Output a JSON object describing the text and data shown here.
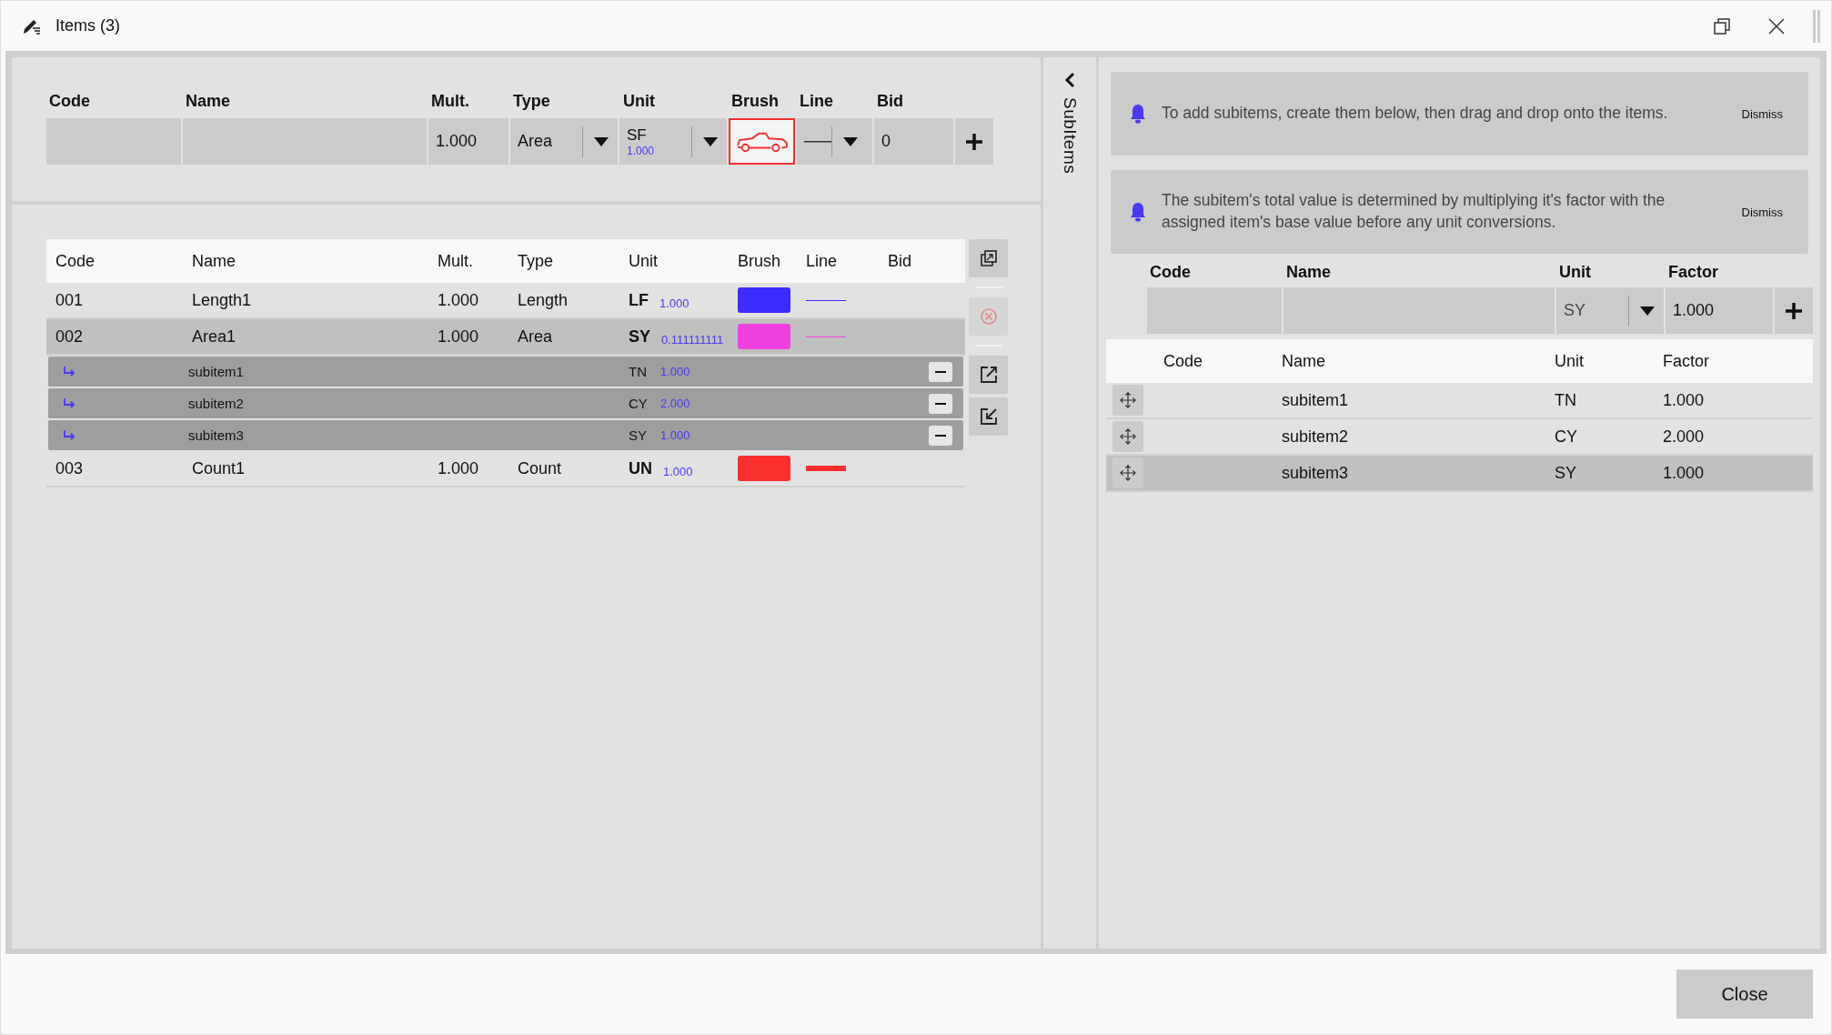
{
  "window": {
    "title": "Items (3)"
  },
  "new_item": {
    "columns": [
      "Code",
      "Name",
      "Mult.",
      "Type",
      "Unit",
      "Brush",
      "Line",
      "Bid"
    ],
    "mult": "1.000",
    "type": "Area",
    "unit": "SF",
    "unit_factor": "1.000",
    "bid": "0"
  },
  "items_table": {
    "columns": [
      "Code",
      "Name",
      "Mult.",
      "Type",
      "Unit",
      "Brush",
      "Line",
      "Bid"
    ],
    "rows": [
      {
        "code": "001",
        "name": "Length1",
        "mult": "1.000",
        "type": "Length",
        "unit": "LF",
        "factor": "1.000",
        "color": "#3c2cff",
        "line": {
          "color": "#3c2cff",
          "kind": "thin"
        },
        "selected": false,
        "children": []
      },
      {
        "code": "002",
        "name": "Area1",
        "mult": "1.000",
        "type": "Area",
        "unit": "SY",
        "factor": "0.111111111",
        "color": "#f040e0",
        "line": {
          "color": "#f040e0",
          "kind": "thin"
        },
        "selected": true,
        "children": [
          {
            "name": "subitem1",
            "unit": "TN",
            "factor": "1.000"
          },
          {
            "name": "subitem2",
            "unit": "CY",
            "factor": "2.000"
          },
          {
            "name": "subitem3",
            "unit": "SY",
            "factor": "1.000"
          }
        ]
      },
      {
        "code": "003",
        "name": "Count1",
        "mult": "1.000",
        "type": "Count",
        "unit": "UN",
        "factor": "1.000",
        "color": "#fa3030",
        "line": {
          "color": "#fa3030",
          "kind": "thick"
        },
        "selected": false,
        "children": []
      }
    ]
  },
  "side_actions": [
    {
      "kind": "copy",
      "disabled": false
    },
    {
      "kind": "delete",
      "disabled": true
    },
    {
      "kind": "export",
      "disabled": false
    },
    {
      "kind": "import",
      "disabled": false
    }
  ],
  "subitems_panel": {
    "tab_label": "SubItems",
    "notices": [
      {
        "text": "To add subitems, create them below, then drag and drop onto the items.",
        "action": "Dismiss"
      },
      {
        "text": "The subitem's total value is determined by multiplying it's factor with the assigned item's base value before any unit conversions.",
        "action": "Dismiss"
      }
    ],
    "new_subitem": {
      "columns": [
        "Code",
        "Name",
        "Unit",
        "Factor"
      ],
      "unit": "SY",
      "factor": "1.000"
    },
    "table": {
      "columns": [
        "Code",
        "Name",
        "Unit",
        "Factor"
      ],
      "rows": [
        {
          "name": "subitem1",
          "unit": "TN",
          "factor": "1.000",
          "selected": false
        },
        {
          "name": "subitem2",
          "unit": "CY",
          "factor": "2.000",
          "selected": false
        },
        {
          "name": "subitem3",
          "unit": "SY",
          "factor": "1.000",
          "selected": true
        }
      ]
    }
  },
  "buttons": [
    "Close"
  ]
}
